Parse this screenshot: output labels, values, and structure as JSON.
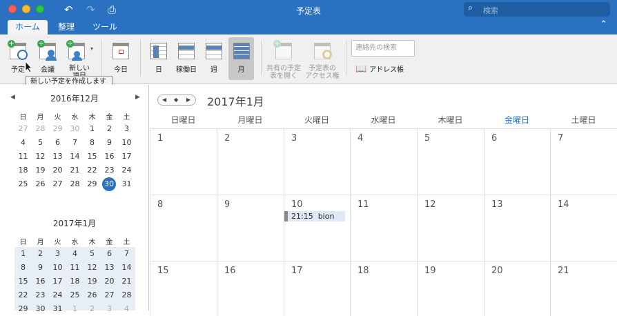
{
  "window": {
    "title": "予定表"
  },
  "search": {
    "placeholder": "検索"
  },
  "tabs": [
    "ホーム",
    "整理",
    "ツール"
  ],
  "ribbon": {
    "new_appointment": "予定",
    "meeting": "会議",
    "new_items_l1": "新しい",
    "new_items_l2": "項目",
    "today": "今日",
    "day": "日",
    "workweek": "稼働日",
    "week": "週",
    "month": "月",
    "open_shared_l1": "共有の予定",
    "open_shared_l2": "表を開く",
    "calendar_perms_l1": "予定表の",
    "calendar_perms_l2": "アクセス権",
    "contact_search_placeholder": "連絡先の検索",
    "address_book": "アドレス帳"
  },
  "tooltip": "新しい予定を作成します",
  "mini_dec": {
    "title": "2016年12月",
    "dow": [
      "日",
      "月",
      "火",
      "水",
      "木",
      "金",
      "土"
    ],
    "weeks": [
      [
        "27",
        "28",
        "29",
        "30",
        "1",
        "2",
        "3"
      ],
      [
        "4",
        "5",
        "6",
        "7",
        "8",
        "9",
        "10"
      ],
      [
        "11",
        "12",
        "13",
        "14",
        "15",
        "16",
        "17"
      ],
      [
        "18",
        "19",
        "20",
        "21",
        "22",
        "23",
        "24"
      ],
      [
        "25",
        "26",
        "27",
        "28",
        "29",
        "30",
        "31"
      ]
    ],
    "today": "30"
  },
  "mini_jan": {
    "title": "2017年1月",
    "dow": [
      "日",
      "月",
      "火",
      "水",
      "木",
      "金",
      "土"
    ],
    "weeks": [
      [
        "1",
        "2",
        "3",
        "4",
        "5",
        "6",
        "7"
      ],
      [
        "8",
        "9",
        "10",
        "11",
        "12",
        "13",
        "14"
      ],
      [
        "15",
        "16",
        "17",
        "18",
        "19",
        "20",
        "21"
      ],
      [
        "22",
        "23",
        "24",
        "25",
        "26",
        "27",
        "28"
      ],
      [
        "29",
        "30",
        "31",
        "1",
        "2",
        "3",
        "4"
      ]
    ]
  },
  "main": {
    "title": "2017年1月",
    "day_headers": [
      "日曜日",
      "月曜日",
      "火曜日",
      "水曜日",
      "木曜日",
      "金曜日",
      "土曜日"
    ],
    "highlight_day": "金曜日",
    "weeks": [
      [
        "1",
        "2",
        "3",
        "4",
        "5",
        "6",
        "7"
      ],
      [
        "8",
        "9",
        "10",
        "11",
        "12",
        "13",
        "14"
      ],
      [
        "15",
        "16",
        "17",
        "18",
        "19",
        "20",
        "21"
      ]
    ]
  },
  "event": {
    "time": "21:15",
    "title": "bion"
  }
}
